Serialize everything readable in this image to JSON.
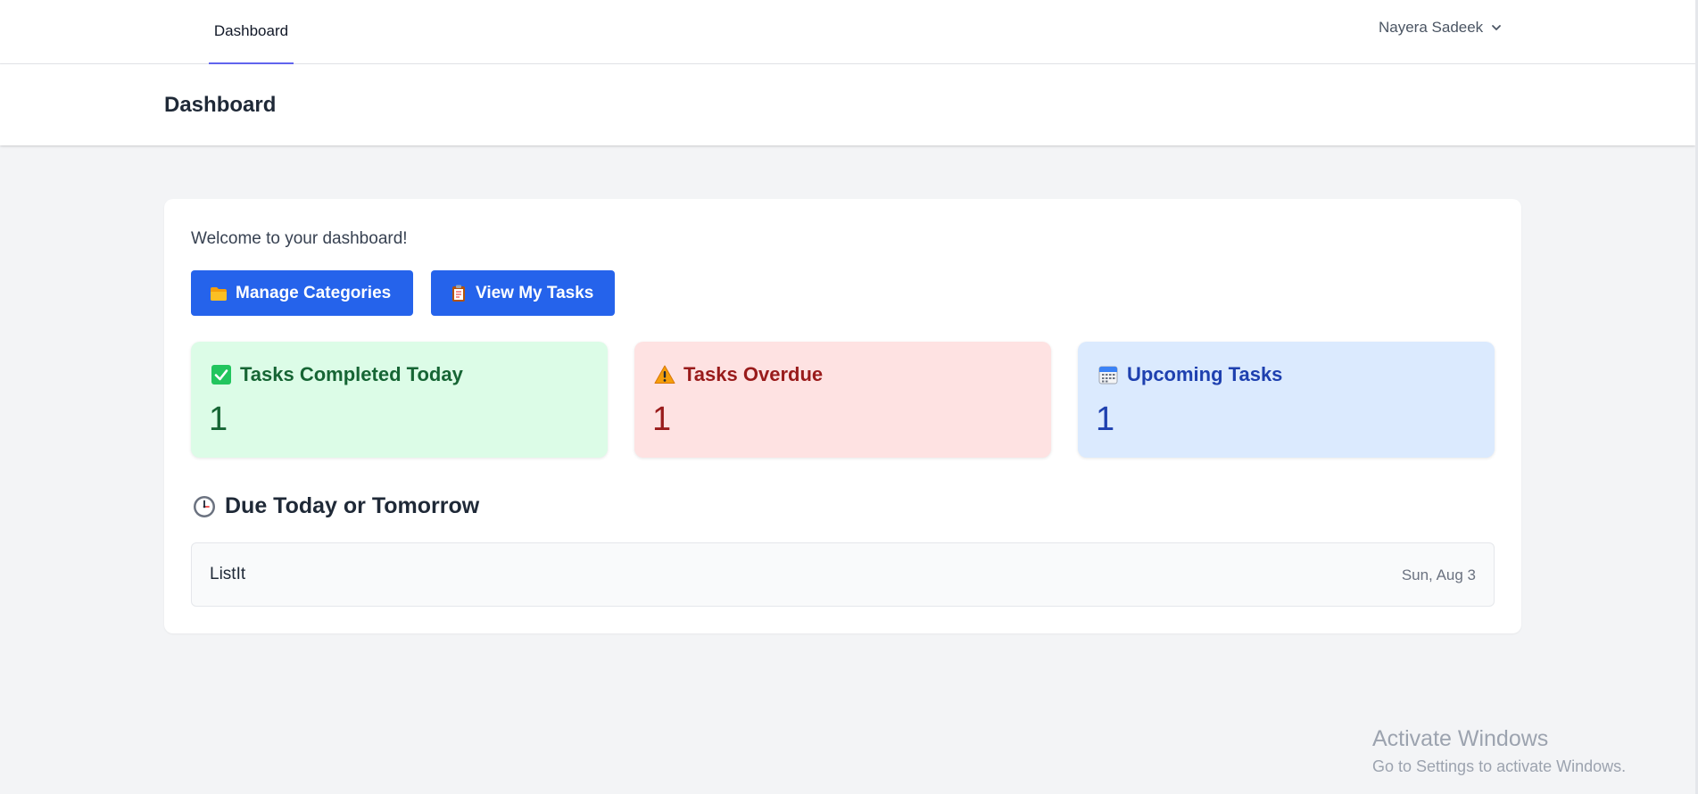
{
  "nav": {
    "links": [
      {
        "label": "Dashboard"
      }
    ],
    "user_name": "Nayera Sadeek"
  },
  "header": {
    "title": "Dashboard"
  },
  "main": {
    "welcome": "Welcome to your dashboard!",
    "buttons": {
      "manage_categories": "Manage Categories",
      "view_tasks": "View My Tasks"
    },
    "stats": [
      {
        "label": "Tasks Completed Today",
        "value": "1",
        "icon": "check-mark-button-icon",
        "color": "#166534",
        "bg": "#dcfce7"
      },
      {
        "label": "Tasks Overdue",
        "value": "1",
        "icon": "warning-icon",
        "color": "#991b1b",
        "bg": "#fee2e2"
      },
      {
        "label": "Upcoming Tasks",
        "value": "1",
        "icon": "calendar-icon",
        "color": "#1e40af",
        "bg": "#dbeafe"
      }
    ],
    "due_section": {
      "title": "Due Today or Tomorrow",
      "icon": "clock-icon",
      "items": [
        {
          "name": "ListIt",
          "date": "Sun, Aug 3"
        }
      ]
    }
  },
  "watermark": {
    "title": "Activate Windows",
    "subtitle": "Go to Settings to activate Windows."
  },
  "colors": {
    "accent": "#2563eb",
    "nav_indicator": "#6366f1",
    "background": "#f3f4f6"
  }
}
